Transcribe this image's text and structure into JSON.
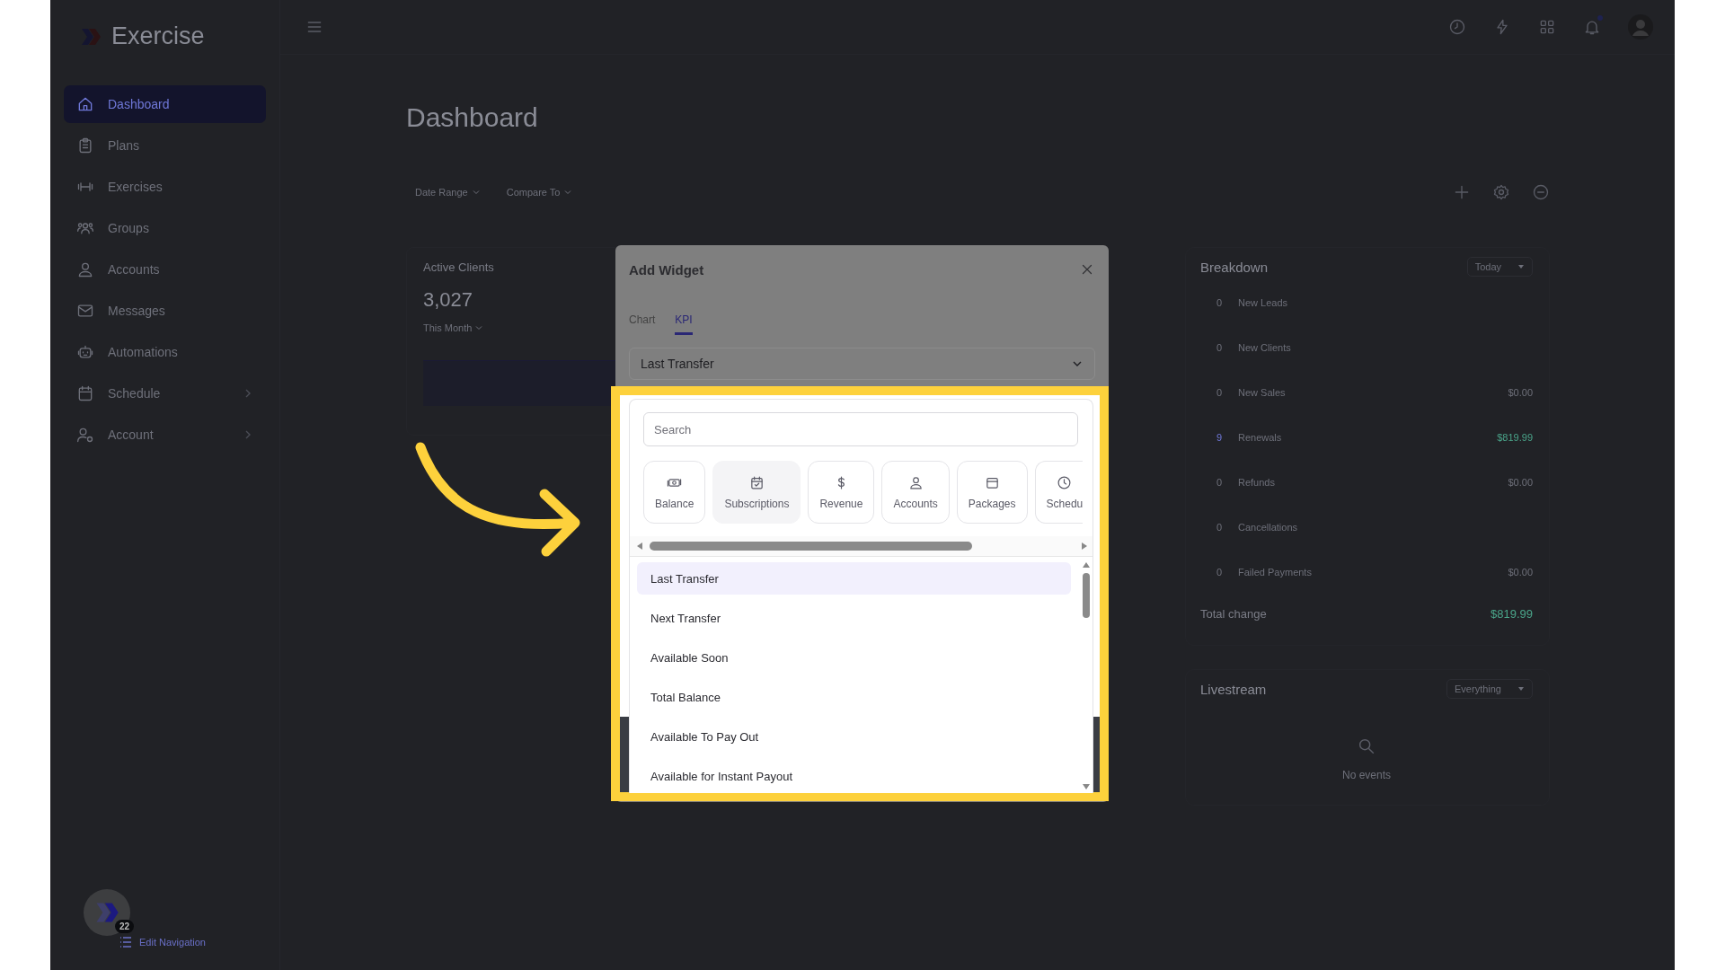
{
  "app": {
    "name": "Exercise"
  },
  "sidebar": {
    "items": [
      {
        "label": "Dashboard",
        "kind": "home",
        "selected": true,
        "has_submenu": false
      },
      {
        "label": "Plans",
        "kind": "clipboard",
        "selected": false,
        "has_submenu": false
      },
      {
        "label": "Exercises",
        "kind": "dumbbell",
        "selected": false,
        "has_submenu": false
      },
      {
        "label": "Groups",
        "kind": "group",
        "selected": false,
        "has_submenu": false
      },
      {
        "label": "Accounts",
        "kind": "person",
        "selected": false,
        "has_submenu": false
      },
      {
        "label": "Messages",
        "kind": "mail",
        "selected": false,
        "has_submenu": false
      },
      {
        "label": "Automations",
        "kind": "robot",
        "selected": false,
        "has_submenu": false
      },
      {
        "label": "Schedule",
        "kind": "calendar",
        "selected": false,
        "has_submenu": true
      },
      {
        "label": "Account",
        "kind": "person-gear",
        "selected": false,
        "has_submenu": true
      }
    ],
    "badge": "22",
    "edit_link": "Edit Navigation"
  },
  "header": {
    "notification_dot": true
  },
  "page": {
    "title": "Dashboard",
    "filters": [
      "Date Range",
      "Compare To"
    ]
  },
  "kpi_card": {
    "title": "Active Clients",
    "value": "3,027",
    "period": "This Month"
  },
  "breakdown": {
    "title": "Breakdown",
    "range": "Today",
    "rows": [
      {
        "count": "0",
        "label": "New Leads",
        "highlighted": false
      },
      {
        "count": "0",
        "label": "New Clients",
        "highlighted": false
      },
      {
        "count": "0",
        "label": "New Sales",
        "amount": "$0.00",
        "highlighted": false
      },
      {
        "count": "9",
        "label": "Renewals",
        "amount": "$819.99",
        "highlighted": true
      },
      {
        "count": "0",
        "label": "Refunds",
        "amount": "$0.00",
        "highlighted": false
      },
      {
        "count": "0",
        "label": "Cancellations",
        "highlighted": false
      },
      {
        "count": "0",
        "label": "Failed Payments",
        "amount": "$0.00",
        "highlighted": false
      }
    ],
    "total_label": "Total change",
    "total_value": "$819.99"
  },
  "livestream": {
    "title": "Livestream",
    "filter": "Everything",
    "empty_text": "No events"
  },
  "dialog": {
    "title": "Add Widget",
    "tabs": [
      {
        "label": "Chart",
        "selected": false
      },
      {
        "label": "KPI",
        "selected": true
      }
    ],
    "select_value": "Last Transfer",
    "search_placeholder": "Search",
    "categories": [
      {
        "label": "Balance",
        "kind": "cash",
        "selected": false
      },
      {
        "label": "Subscriptions",
        "kind": "calendar-check",
        "selected": true
      },
      {
        "label": "Revenue",
        "kind": "dollar",
        "selected": false
      },
      {
        "label": "Accounts",
        "kind": "person",
        "selected": false
      },
      {
        "label": "Packages",
        "kind": "box",
        "selected": false
      },
      {
        "label": "Schedu",
        "kind": "clock",
        "selected": false
      }
    ],
    "options": [
      {
        "label": "Last Transfer",
        "selected": true
      },
      {
        "label": "Next Transfer",
        "selected": false
      },
      {
        "label": "Available Soon",
        "selected": false
      },
      {
        "label": "Total Balance",
        "selected": false
      },
      {
        "label": "Available To Pay Out",
        "selected": false
      },
      {
        "label": "Available for Instant Payout",
        "selected": false
      }
    ]
  }
}
